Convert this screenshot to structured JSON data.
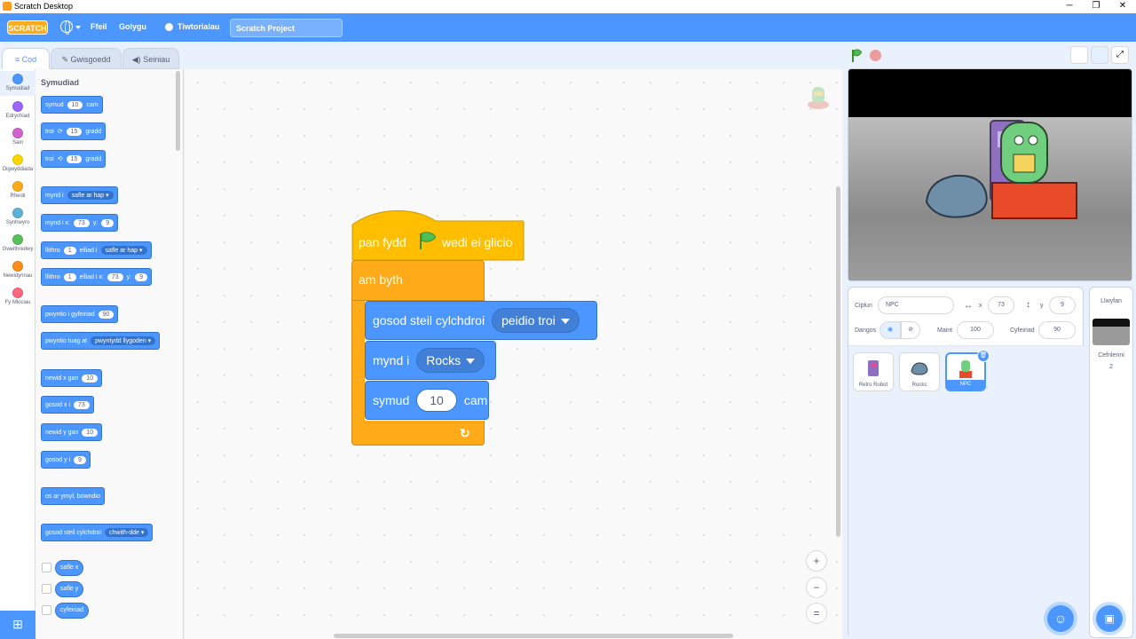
{
  "window": {
    "title": "Scratch Desktop",
    "minimize": "─",
    "maximize": "❐",
    "close": "✕"
  },
  "menubar": {
    "logo": "SCRATCH",
    "file": "Ffeil",
    "edit": "Golygu",
    "tutorials": "Tiwtorialau",
    "project_name": "Scratch Project"
  },
  "tabs": {
    "code": "Cod",
    "costumes": "Gwisgoedd",
    "sounds": "Seiniau"
  },
  "categories": [
    {
      "label": "Symudiad",
      "color": "#4c97ff"
    },
    {
      "label": "Edrychiad",
      "color": "#9966ff"
    },
    {
      "label": "Sain",
      "color": "#cf63cf"
    },
    {
      "label": "Digwyddiada",
      "color": "#ffd500"
    },
    {
      "label": "Rheoli",
      "color": "#ffab19"
    },
    {
      "label": "Synhwyro",
      "color": "#5cb1d6"
    },
    {
      "label": "Gweithredwy",
      "color": "#59c059"
    },
    {
      "label": "Newidynnau",
      "color": "#ff8c1a"
    },
    {
      "label": "Fy Mlociau",
      "color": "#ff6680"
    }
  ],
  "palette": {
    "title": "Symudiad",
    "blocks": {
      "move": {
        "a": "symud",
        "v": "10",
        "b": "cam"
      },
      "turn_right": {
        "a": "troi",
        "icon": "⟳",
        "v": "15",
        "b": "gradd"
      },
      "turn_left": {
        "a": "troi",
        "icon": "⟲",
        "v": "15",
        "b": "gradd"
      },
      "goto": {
        "a": "mynd i",
        "d": "safle ar hap"
      },
      "goto_xy": {
        "a": "mynd i x:",
        "x": "73",
        "b": "y:",
        "y": "9"
      },
      "glide": {
        "a": "llithro",
        "v": "1",
        "b": "eiliad i",
        "d": "safle ar hap"
      },
      "glide_xy": {
        "a": "llithro",
        "v": "1",
        "b": "eiliad i x:",
        "x": "73",
        "c": "y:",
        "y": "9"
      },
      "point_dir": {
        "a": "pwyntio i gyfeiriad",
        "v": "90"
      },
      "point_towards": {
        "a": "pwyntio tuag at",
        "d": "pwyntydd llygoden"
      },
      "change_x": {
        "a": "newid x gan",
        "v": "10"
      },
      "set_x": {
        "a": "gosod x i",
        "v": "73"
      },
      "change_y": {
        "a": "newid y gan",
        "v": "10"
      },
      "set_y": {
        "a": "gosod y i",
        "v": "9"
      },
      "bounce": {
        "a": "os ar ymyl, bowndio"
      },
      "rotation_style": {
        "a": "gosod steil cylchdroi",
        "d": "chwith-dde"
      }
    },
    "reporters": [
      "safle x",
      "safle y",
      "cyfeiriad"
    ]
  },
  "script": {
    "hat": {
      "a": "pan fydd",
      "b": "wedi ei glicio"
    },
    "forever": "am byth",
    "set_rotation": {
      "a": "gosod steil cylchdroi",
      "d": "peidio troi"
    },
    "goto": {
      "a": "mynd i",
      "d": "Rocks"
    },
    "move": {
      "a": "symud",
      "v": "10",
      "b": "cam"
    }
  },
  "zoom": {
    "in": "+",
    "out": "−",
    "reset": "="
  },
  "sprite_info": {
    "sprite_label": "Ciplun",
    "sprite_name": "NPC",
    "x_label": "x",
    "x_value": "73",
    "y_label": "y",
    "y_value": "9",
    "show_label": "Dangos",
    "size_label": "Maint",
    "size_value": "100",
    "direction_label": "Cyfeiriad",
    "direction_value": "90"
  },
  "sprites": [
    {
      "name": "Retro Robot",
      "selected": false
    },
    {
      "name": "Rocks",
      "selected": false
    },
    {
      "name": "NPC",
      "selected": true
    }
  ],
  "stage_pane": {
    "title": "Llwyfan",
    "backdrops_label": "Cefnlenni",
    "backdrops_count": "2"
  },
  "colors": {
    "motion": "#4c97ff",
    "control": "#ffab19",
    "events": "#ffbf00",
    "menubar": "#4c97ff"
  }
}
